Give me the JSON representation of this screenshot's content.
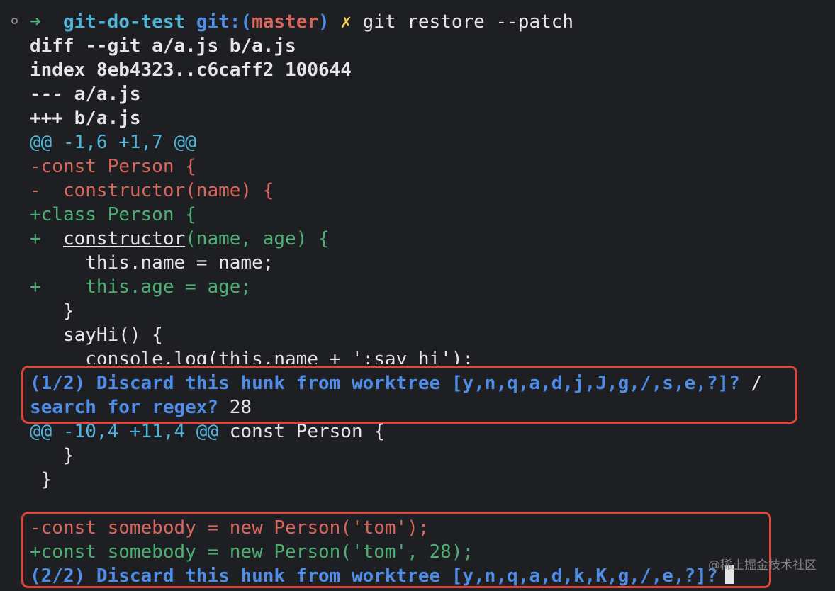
{
  "prompt": {
    "arrow": "➜",
    "dir": "git-do-test",
    "git_prefix": "git:(",
    "branch": "master",
    "git_suffix": ")",
    "dirty_mark": "✗",
    "command": "git restore --patch"
  },
  "diff_header": {
    "line1": "diff --git a/a.js b/a.js",
    "line2": "index 8eb4323..c6caff2 100644",
    "line3": "--- a/a.js",
    "line4": "+++ b/a.js"
  },
  "hunk1": {
    "header": "@@ -1,6 +1,7 @@",
    "removed": [
      "-const Person {",
      "-  constructor(name) {"
    ],
    "added1": "+class Person {",
    "added2_prefix": "+  ",
    "added2_underlined": "constructor",
    "added2_rest": "(name, age) {",
    "context1": "     this.name = name;",
    "added3_prefix": "+    ",
    "added3_code": "this.age = age;",
    "context2": "   }",
    "context3": "   sayHi() {",
    "context4": "     console.log(this.name + ':say hi');"
  },
  "prompt1": {
    "question": "(1/2) Discard this hunk from worktree [y,n,q,a,d,j,J,g,/,s,e,?]? ",
    "slash": "/",
    "search_label": "search for regex?",
    "search_value": " 28"
  },
  "hunk2": {
    "header_at": "@@ -10,4 +11,4 @@",
    "header_context": " const Person {",
    "context1": "   }",
    "context2": " }",
    "removed": "-const somebody = new Person('tom');",
    "added": "+const somebody = new Person('tom', 28);"
  },
  "prompt2": {
    "question": "(2/2) Discard this hunk from worktree [y,n,q,a,d,k,K,g,/,e,?]?"
  },
  "watermark": "@稀土掘金技术社区",
  "colors": {
    "background": "#1e1f22",
    "removed": "#d9665d",
    "added": "#4caf73",
    "prompt_blue": "#4f8de8",
    "highlight_border": "#e0453b"
  }
}
